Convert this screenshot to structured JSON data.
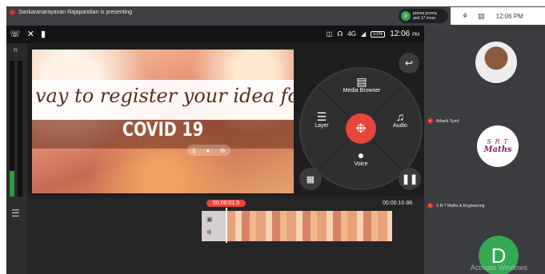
{
  "meet": {
    "presenting_text": "Sankaranarayanan Rajapandian is presenting",
    "attendees_line1": "prema prema",
    "attendees_line2": "and 17 more",
    "attendee_initial": "p",
    "time": "12:06 PM"
  },
  "phone": {
    "status_time": "12:06",
    "status_ampm": "PM",
    "battery": "51%",
    "signal_label": "4G",
    "left_label": "R",
    "preview_text": "vay to register your idea for",
    "preview_title": "COVID 19",
    "menu": {
      "media_browser": "Media Browser",
      "layer": "Layer",
      "audio": "Audio",
      "voice": "Voice"
    },
    "timeline": {
      "current_time": "00:00:01.5",
      "total_time": "00:00:10.88"
    }
  },
  "participants": [
    {
      "name": "Atharik Syed"
    },
    {
      "name": "S R T Maths & Engineering",
      "logo_line1": "S R T",
      "logo_line2": "Maths"
    },
    {
      "initial": "D"
    }
  ],
  "watermark": "Activate Windows",
  "colors": {
    "record": "#e8453c",
    "avatar_green": "#34a853",
    "mic_off": "#d93025"
  }
}
